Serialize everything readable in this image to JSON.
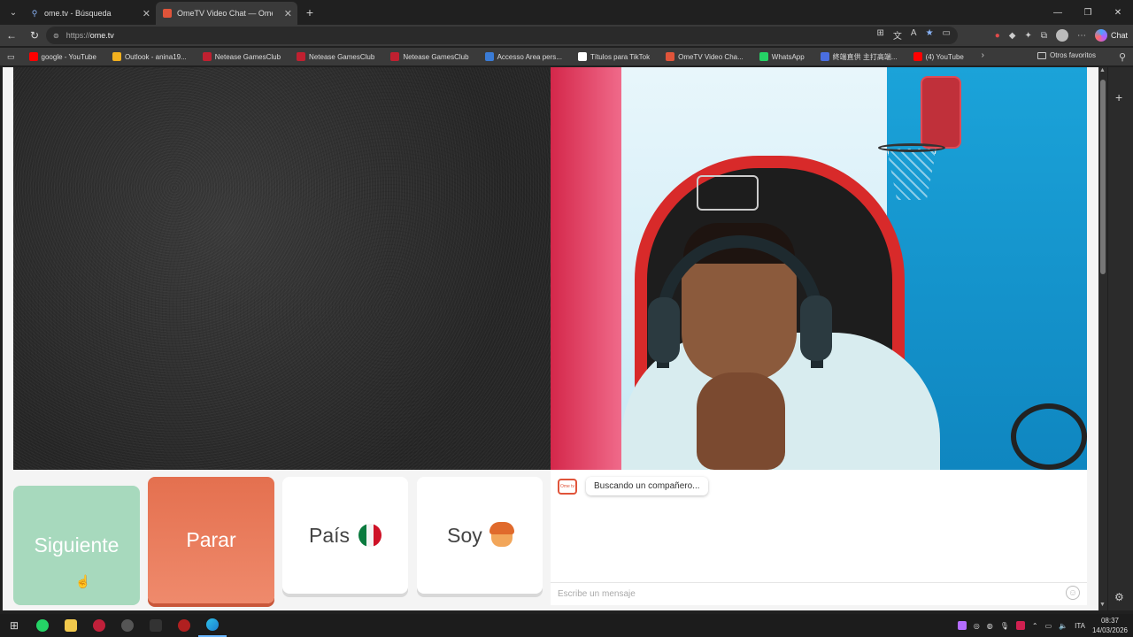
{
  "browser": {
    "tabs": [
      {
        "title": "ome.tv - Búsqueda",
        "active": false
      },
      {
        "title": "OmeTV Video Chat — Omegl",
        "active": true
      }
    ],
    "url_prefix": "https://",
    "url_host": "ome.tv",
    "chat_button_label": "Chat"
  },
  "bookmarks": [
    {
      "label": "google - YouTube",
      "color": "#ff0000"
    },
    {
      "label": "Outlook - anina19...",
      "color": "#f2b01e"
    },
    {
      "label": "Netease GamesClub",
      "color": "#c02030"
    },
    {
      "label": "Netease GamesClub",
      "color": "#c02030"
    },
    {
      "label": "Netease GamesClub",
      "color": "#c02030"
    },
    {
      "label": "Accesso Area pers...",
      "color": "#3a7bd5"
    },
    {
      "label": "Títulos para TikTok",
      "color": "#ffffff"
    },
    {
      "label": "OmeTV Video Cha...",
      "color": "#e0543a"
    },
    {
      "label": "WhatsApp",
      "color": "#25d366"
    },
    {
      "label": "終端直供 主打高端...",
      "color": "#4a6ee0"
    },
    {
      "label": "(4) YouTube",
      "color": "#ff0000"
    }
  ],
  "other_favorites": "Otros favoritos",
  "ometv": {
    "next_label": "Siguiente",
    "stop_label": "Parar",
    "country_label": "País",
    "gender_label": "Soy",
    "status_message": "Buscando un compañero...",
    "message_placeholder": "Escribe un mensaje",
    "logo_text": "Ome tv"
  },
  "colors": {
    "next_button": "#a7d9bd",
    "stop_button": "#e4704f"
  },
  "taskbar": {
    "lang": "ITA",
    "time": "08:37",
    "date": "14/03/2026"
  }
}
